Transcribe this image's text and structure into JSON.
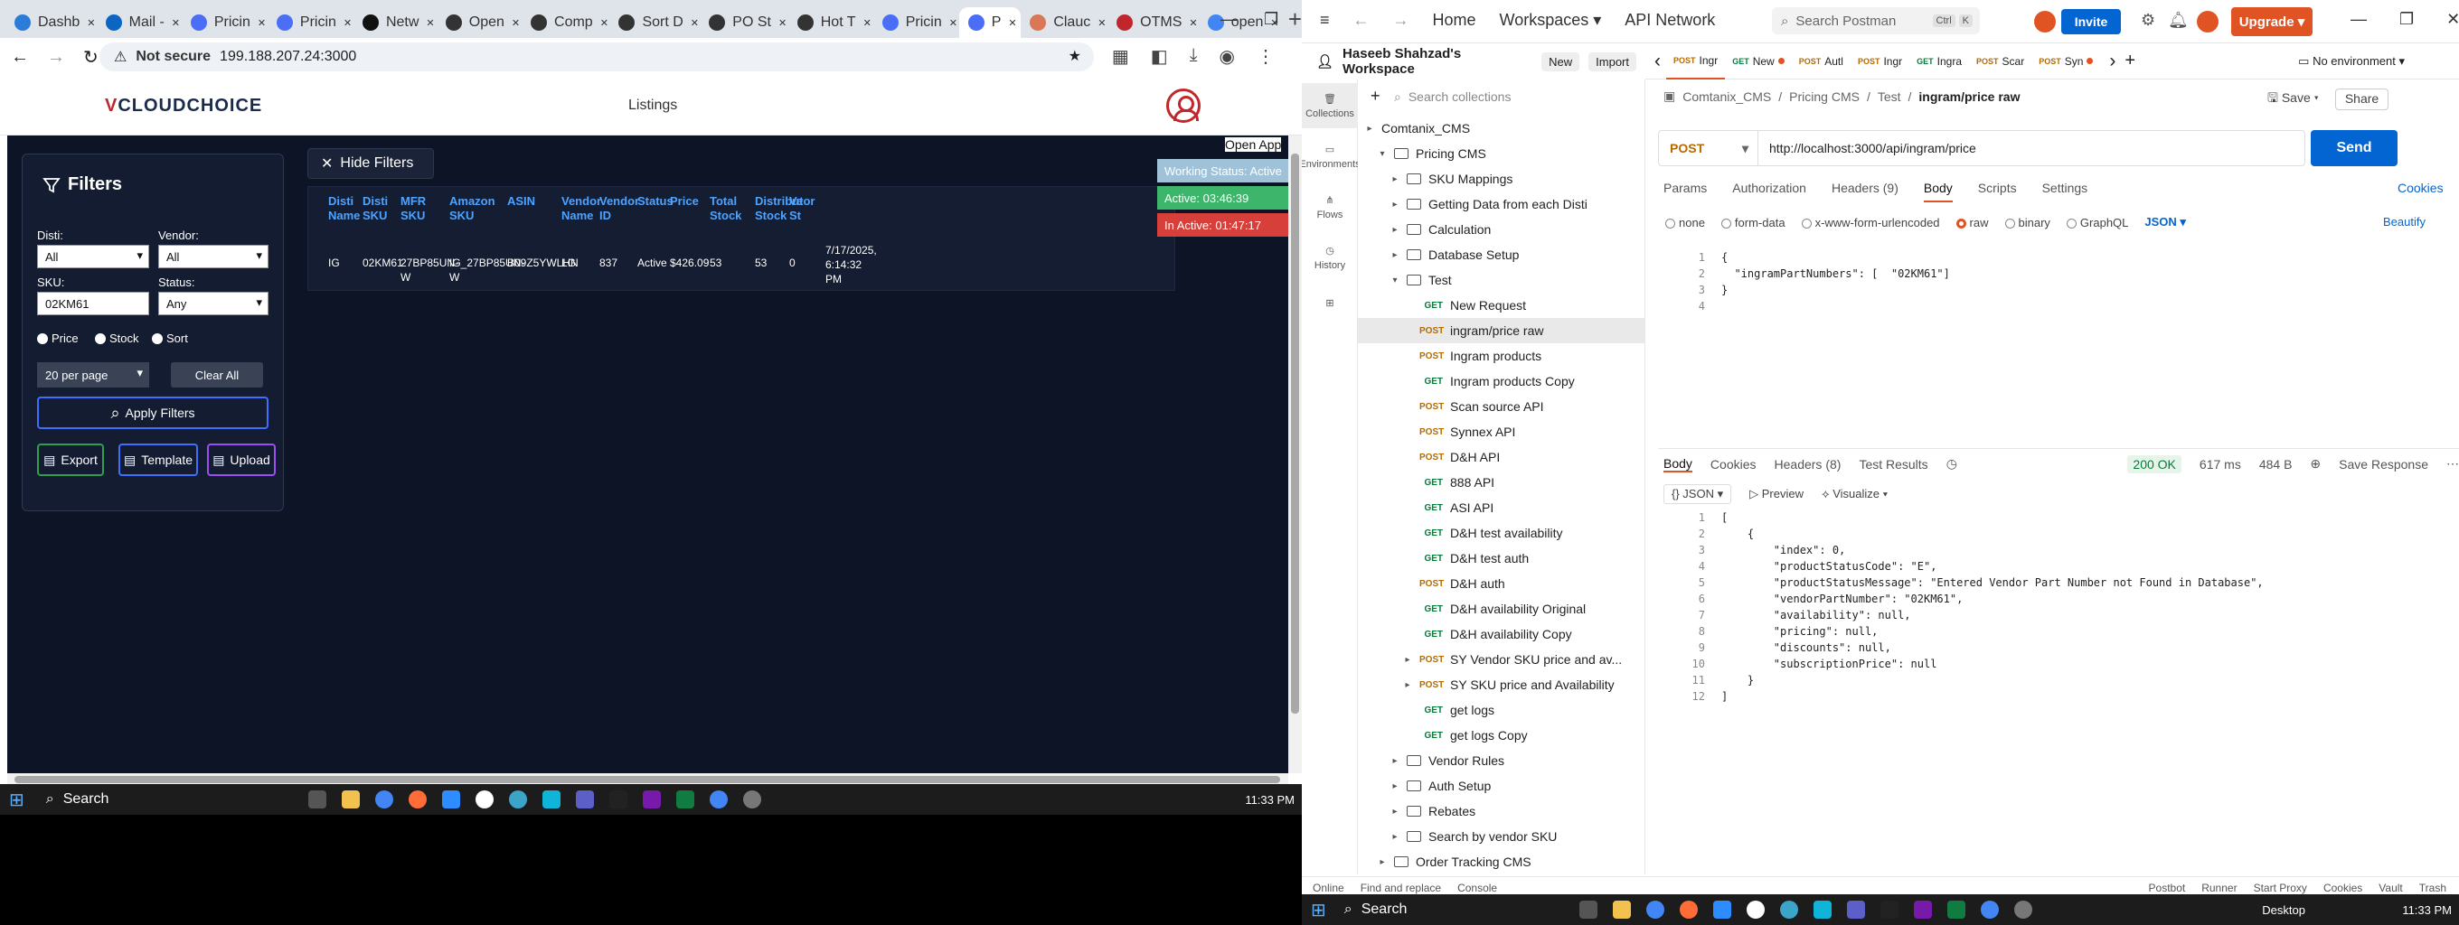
{
  "chrome": {
    "tabs": [
      {
        "label": "Dashb",
        "color": "#2b7bd8"
      },
      {
        "label": "Mail -",
        "color": "#0a66c2"
      },
      {
        "label": "Pricin",
        "color": "#4a6ef5"
      },
      {
        "label": "Pricin",
        "color": "#4a6ef5"
      },
      {
        "label": "Netw",
        "color": "#111"
      },
      {
        "label": "Open",
        "color": "#333"
      },
      {
        "label": "Comp",
        "color": "#333"
      },
      {
        "label": "Sort D",
        "color": "#333"
      },
      {
        "label": "PO St",
        "color": "#333"
      },
      {
        "label": "Hot T",
        "color": "#333"
      },
      {
        "label": "Pricin",
        "color": "#4a6ef5"
      },
      {
        "label": "P",
        "color": "#4a6ef5",
        "active": true
      },
      {
        "label": "Clauc",
        "color": "#d97757"
      },
      {
        "label": "OTMS",
        "color": "#c0272d"
      },
      {
        "label": "open",
        "color": "#4285f4"
      }
    ],
    "security": "Not secure",
    "url": "199.188.207.24:3000"
  },
  "app": {
    "logo_main": "CLOUDCHOICE",
    "logo_prefix": "V",
    "nav_title": "Listings",
    "open_app": "Open App",
    "status": {
      "working": "Working Status: Active",
      "active": "Active: 03:46:39",
      "inactive": "In Active: 01:47:17"
    },
    "filters": {
      "title": "Filters",
      "disti_label": "Disti:",
      "disti_value": "All",
      "vendor_label": "Vendor:",
      "vendor_value": "All",
      "sku_label": "SKU:",
      "sku_value": "02KM61",
      "status_label": "Status:",
      "status_value": "Any",
      "radio_price": "Price",
      "radio_stock": "Stock",
      "radio_sort": "Sort",
      "per_page": "20 per page",
      "clear_all": "Clear All",
      "apply": "Apply Filters",
      "export": "Export",
      "template": "Template",
      "upload": "Upload"
    },
    "hide_filters": "Hide Filters",
    "table": {
      "headers": [
        "Disti Name",
        "Disti SKU",
        "MFR SKU",
        "Amazon SKU",
        "ASIN",
        "Vendor Name",
        "Vendor ID",
        "Status",
        "Price",
        "Total Stock",
        "Distributor Stock",
        "Ve St"
      ],
      "row": [
        "IG",
        "02KM61",
        "27BP85UN-W",
        "IG_27BP85UN-W",
        "B09Z5YWLHN",
        "LG",
        "837",
        "Active",
        "$426.09",
        "53",
        "53",
        "0",
        "7/17/2025, 6:14:32 PM"
      ]
    }
  },
  "taskbar_left": {
    "search": "Search",
    "time": "11:33 PM"
  },
  "taskbar_right": {
    "search": "Search",
    "desktop": "Desktop",
    "time": "11:33 PM"
  },
  "postman": {
    "nav": {
      "home": "Home",
      "workspaces": "Workspaces",
      "api_network": "API Network"
    },
    "search": "Search Postman",
    "kbd1": "Ctrl",
    "kbd2": "K",
    "invite": "Invite",
    "upgrade": "Upgrade",
    "workspace": "Haseeb Shahzad's Workspace",
    "new": "New",
    "import": "Import",
    "rail": [
      "Collections",
      "Environments",
      "Flows",
      "History"
    ],
    "side_search": "Search collections",
    "tree": [
      {
        "label": "Comtanix_CMS",
        "kind": "root",
        "indent": 0
      },
      {
        "label": "Pricing CMS",
        "kind": "folder",
        "indent": 1,
        "open": true
      },
      {
        "label": "SKU Mappings",
        "kind": "folder",
        "indent": 2
      },
      {
        "label": "Getting Data from each Disti",
        "kind": "folder",
        "indent": 2
      },
      {
        "label": "Calculation",
        "kind": "folder",
        "indent": 2
      },
      {
        "label": "Database Setup",
        "kind": "folder",
        "indent": 2
      },
      {
        "label": "Test",
        "kind": "folder",
        "indent": 2,
        "open": true
      },
      {
        "label": "New Request",
        "method": "GET",
        "indent": 3
      },
      {
        "label": "ingram/price raw",
        "method": "POST",
        "indent": 3,
        "selected": true
      },
      {
        "label": "Ingram products",
        "method": "POST",
        "indent": 3
      },
      {
        "label": "Ingram products Copy",
        "method": "GET",
        "indent": 3
      },
      {
        "label": "Scan source API",
        "method": "POST",
        "indent": 3
      },
      {
        "label": "Synnex API",
        "method": "POST",
        "indent": 3
      },
      {
        "label": "D&H API",
        "method": "POST",
        "indent": 3
      },
      {
        "label": "888 API",
        "method": "GET",
        "indent": 3
      },
      {
        "label": "ASI API",
        "method": "GET",
        "indent": 3
      },
      {
        "label": "D&H test availability",
        "method": "GET",
        "indent": 3
      },
      {
        "label": "D&H test auth",
        "method": "GET",
        "indent": 3
      },
      {
        "label": "D&H auth",
        "method": "POST",
        "indent": 3
      },
      {
        "label": "D&H availability Original",
        "method": "GET",
        "indent": 3
      },
      {
        "label": "D&H availability Copy",
        "method": "GET",
        "indent": 3
      },
      {
        "label": "SY Vendor SKU price and av...",
        "method": "POST",
        "indent": 3,
        "chev": true
      },
      {
        "label": "SY SKU price and Availability",
        "method": "POST",
        "indent": 3,
        "chev": true
      },
      {
        "label": "get logs",
        "method": "GET",
        "indent": 3
      },
      {
        "label": "get logs Copy",
        "method": "GET",
        "indent": 3
      },
      {
        "label": "Vendor Rules",
        "kind": "folder",
        "indent": 2
      },
      {
        "label": "Auth Setup",
        "kind": "folder",
        "indent": 2
      },
      {
        "label": "Rebates",
        "kind": "folder",
        "indent": 2
      },
      {
        "label": "Search by vendor SKU",
        "kind": "folder",
        "indent": 2
      },
      {
        "label": "Order Tracking CMS",
        "kind": "folder",
        "indent": 1
      }
    ],
    "tabs": [
      {
        "method": "POST",
        "label": "Ingr",
        "active": true
      },
      {
        "method": "GET",
        "label": "New",
        "dot": true
      },
      {
        "method": "POST",
        "label": "Autl"
      },
      {
        "method": "POST",
        "label": "Ingr"
      },
      {
        "method": "GET",
        "label": "Ingra"
      },
      {
        "method": "POST",
        "label": "Scar"
      },
      {
        "method": "POST",
        "label": "Syn",
        "dot": true
      }
    ],
    "environment": "No environment",
    "breadcrumb": [
      "Comtanix_CMS",
      "Pricing CMS",
      "Test"
    ],
    "request_name": "ingram/price raw",
    "save": "Save",
    "share": "Share",
    "method": "POST",
    "url": "http://localhost:3000/api/ingram/price",
    "send": "Send",
    "req_tabs": [
      "Params",
      "Authorization",
      "Headers (9)",
      "Body",
      "Scripts",
      "Settings"
    ],
    "cookies": "Cookies",
    "body_types": [
      "none",
      "form-data",
      "x-www-form-urlencoded",
      "raw",
      "binary",
      "GraphQL"
    ],
    "body_format": "JSON",
    "beautify": "Beautify",
    "req_body": [
      "{",
      "  \"ingramPartNumbers\": [  \"02KM61\"]",
      "}",
      ""
    ],
    "res_tabs": [
      "Body",
      "Cookies",
      "Headers (8)",
      "Test Results"
    ],
    "res_status": "200 OK",
    "res_time": "617 ms",
    "res_size": "484 B",
    "save_response": "Save Response",
    "res_format": "JSON",
    "preview": "Preview",
    "visualize": "Visualize",
    "res_body": [
      "[",
      "    {",
      "        \"index\": 0,",
      "        \"productStatusCode\": \"E\",",
      "        \"productStatusMessage\": \"Entered Vendor Part Number not Found in Database\",",
      "        \"vendorPartNumber\": \"02KM61\",",
      "        \"availability\": null,",
      "        \"pricing\": null,",
      "        \"discounts\": null,",
      "        \"subscriptionPrice\": null",
      "    }",
      "]"
    ],
    "statusbar": {
      "online": "Online",
      "find": "Find and replace",
      "console": "Console",
      "postbot": "Postbot",
      "runner": "Runner",
      "proxy": "Start Proxy",
      "cookies": "Cookies",
      "vault": "Vault",
      "trash": "Trash"
    }
  }
}
